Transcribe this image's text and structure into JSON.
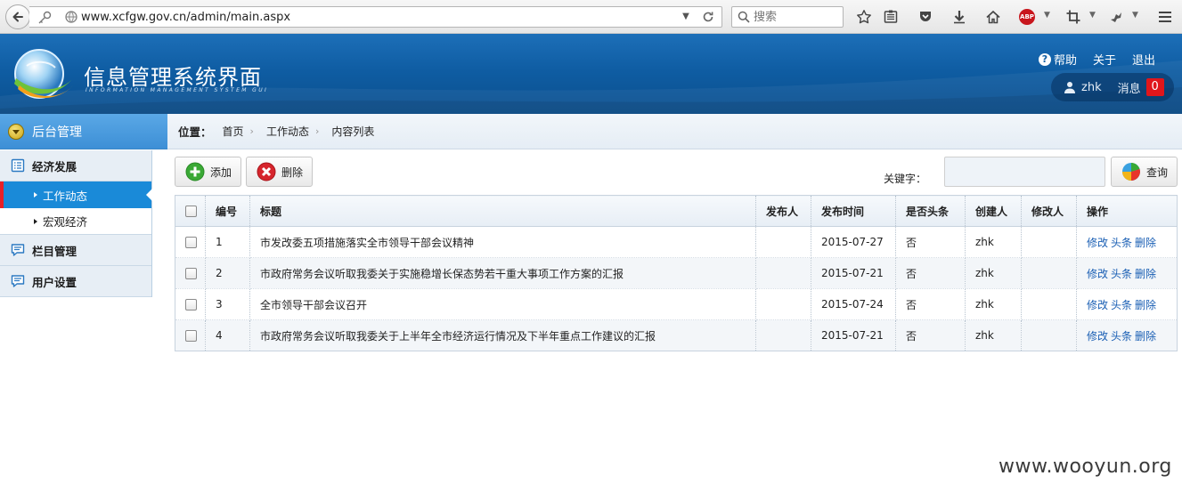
{
  "browser": {
    "url": "www.xcfgw.gov.cn/admin/main.aspx",
    "search_placeholder": "搜索",
    "abp_label": "ABP"
  },
  "header": {
    "title": "信息管理系统界面",
    "subtitle": "INFORMATION MANAGEMENT SYSTEM GUI",
    "help": "帮助",
    "about": "关于",
    "logout": "退出",
    "username": "zhk",
    "messages_label": "消息",
    "messages_count": "0"
  },
  "sidebar": {
    "head": "后台管理",
    "groups": [
      {
        "label": "经济发展",
        "items": [
          {
            "label": "工作动态",
            "active": true
          },
          {
            "label": "宏观经济",
            "active": false
          }
        ]
      },
      {
        "label": "栏目管理"
      },
      {
        "label": "用户设置"
      }
    ]
  },
  "breadcrumb": {
    "label": "位置：",
    "items": [
      "首页",
      "工作动态",
      "内容列表"
    ]
  },
  "toolbar": {
    "add": "添加",
    "delete": "删除",
    "keyword_label": "关键字：",
    "keyword_value": "",
    "query": "查询"
  },
  "table": {
    "columns": [
      "",
      "编号",
      "标题",
      "发布人",
      "发布时间",
      "是否头条",
      "创建人",
      "修改人",
      "操作"
    ],
    "rows": [
      {
        "id": "1",
        "title": "市发改委五项措施落实全市领导干部会议精神",
        "publisher": "",
        "date": "2015-07-27",
        "headline": "否",
        "creator": "zhk",
        "modifier": ""
      },
      {
        "id": "2",
        "title": "市政府常务会议听取我委关于实施稳增长保态势若干重大事项工作方案的汇报",
        "publisher": "",
        "date": "2015-07-21",
        "headline": "否",
        "creator": "zhk",
        "modifier": ""
      },
      {
        "id": "3",
        "title": "全市领导干部会议召开",
        "publisher": "",
        "date": "2015-07-24",
        "headline": "否",
        "creator": "zhk",
        "modifier": ""
      },
      {
        "id": "4",
        "title": "市政府常务会议听取我委关于上半年全市经济运行情况及下半年重点工作建议的汇报",
        "publisher": "",
        "date": "2015-07-21",
        "headline": "否",
        "creator": "zhk",
        "modifier": ""
      }
    ],
    "ops": [
      "修改",
      "头条",
      "删除"
    ]
  },
  "watermark": "www.wooyun.org",
  "colors": {
    "header_blue": "#0f5da3",
    "active_blue": "#1a8ad8",
    "active_marker": "#e82027",
    "link": "#1a5fb4",
    "badge_red": "#e0161b"
  }
}
